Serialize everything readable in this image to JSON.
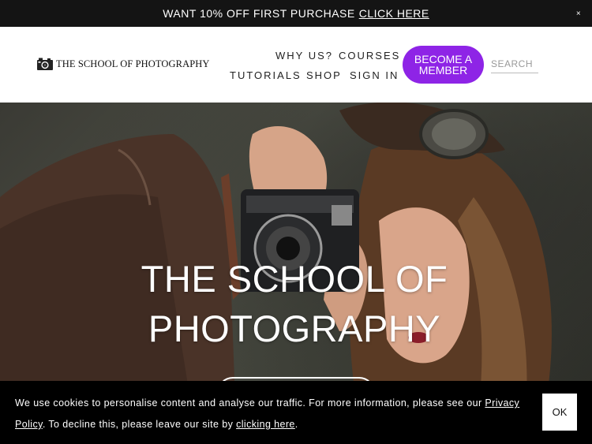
{
  "announcement": {
    "text": "WANT 10% OFF FIRST PURCHASE",
    "link_label": "CLICK HERE",
    "close_label": "×"
  },
  "header": {
    "logo_text": "THE SCHOOL OF PHOTOGRAPHY",
    "nav": {
      "why_us": "WHY US?",
      "courses": "COURSES",
      "tutorials": "TUTORIALS",
      "shop": "SHOP",
      "sign_in": "SIGN IN"
    },
    "member_button_line1": "BECOME A",
    "member_button_line2": "MEMBER",
    "search_placeholder": "SEARCH"
  },
  "hero": {
    "title_line1": "THE SCHOOL OF",
    "title_line2": "PHOTOGRAPHY"
  },
  "cookie": {
    "text_before_privacy": "We use cookies to personalise content and analyse our traffic. For more information, please see our ",
    "privacy_link": "Privacy Policy",
    "text_middle": ". To decline this, please leave our site by ",
    "leave_link": "clicking here",
    "text_end": ".",
    "ok_label": "OK"
  },
  "colors": {
    "announcement_bg": "#141414",
    "accent_purple": "#8e24e6",
    "cookie_bg": "#000000"
  },
  "icons": [
    "camera-logo-icon",
    "close-icon"
  ]
}
